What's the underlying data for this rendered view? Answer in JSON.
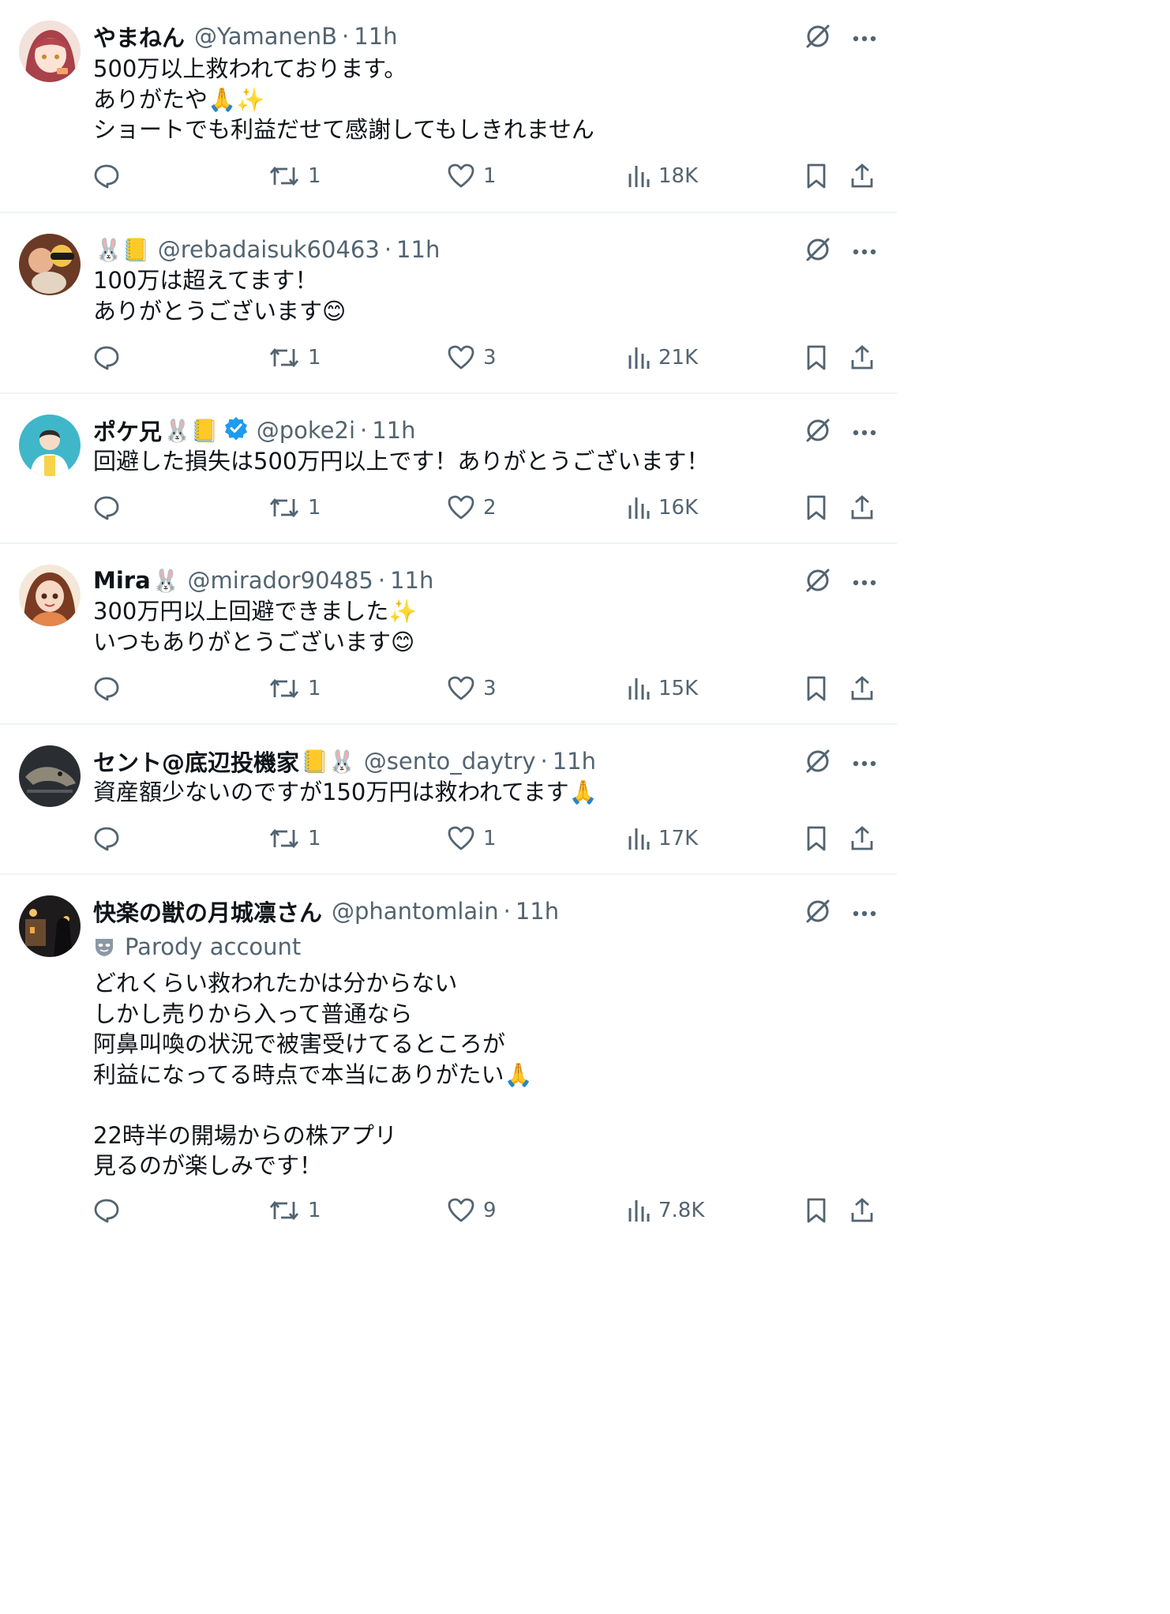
{
  "posts": [
    {
      "name": "やまねん",
      "name_emojis": "",
      "verified": false,
      "handle": "@YamanenB",
      "time": "11h",
      "parody_label": "",
      "text": "500万以上救われております。\nありがたや🙏✨\nショートでも利益だせて感謝してもしきれません",
      "stats": {
        "replies": "",
        "reposts": "1",
        "likes": "1",
        "views": "18K"
      }
    },
    {
      "name": "",
      "name_emojis": "🐰📒",
      "verified": false,
      "handle": "@rebadaisuk60463",
      "time": "11h",
      "parody_label": "",
      "text": "100万は超えてます！\nありがとうございます😊",
      "stats": {
        "replies": "",
        "reposts": "1",
        "likes": "3",
        "views": "21K"
      }
    },
    {
      "name": "ポケ兄",
      "name_emojis": "🐰📒",
      "verified": true,
      "handle": "@poke2i",
      "time": "11h",
      "parody_label": "",
      "text": "回避した損失は500万円以上です！ありがとうございます！",
      "stats": {
        "replies": "",
        "reposts": "1",
        "likes": "2",
        "views": "16K"
      }
    },
    {
      "name": "Mira",
      "name_emojis": "🐰",
      "verified": false,
      "handle": "@mirador90485",
      "time": "11h",
      "parody_label": "",
      "text": "300万円以上回避できました✨\nいつもありがとうございます😊",
      "stats": {
        "replies": "",
        "reposts": "1",
        "likes": "3",
        "views": "15K"
      }
    },
    {
      "name": "セント@底辺投機家",
      "name_emojis": "📒🐰",
      "verified": false,
      "handle": "@sento_daytry",
      "time": "11h",
      "parody_label": "",
      "text": "資産額少ないのですが150万円は救われてます🙏",
      "stats": {
        "replies": "",
        "reposts": "1",
        "likes": "1",
        "views": "17K"
      }
    },
    {
      "name": "快楽の獣の月城凛さん",
      "name_emojis": "",
      "verified": false,
      "handle": "@phantomlain",
      "time": "11h",
      "parody_label": "Parody account",
      "text": "どれくらい救われたかは分からない\nしかし売りから入って普通なら\n阿鼻叫喚の状況で被害受けてるところが\n利益になってる時点で本当にありがたい🙏\n\n22時半の開場からの株アプリ\n見るのが楽しみです！",
      "stats": {
        "replies": "",
        "reposts": "1",
        "likes": "9",
        "views": "7.8K"
      }
    }
  ],
  "icons": {
    "reply": "reply-icon",
    "repost": "repost-icon",
    "like": "heart-icon",
    "views": "views-icon",
    "bookmark": "bookmark-icon",
    "share": "share-icon",
    "grok": "grok-icon",
    "more": "more-icon",
    "parody": "parody-mask-icon",
    "verified": "verified-badge-icon"
  },
  "colors": {
    "text": "#0f1419",
    "secondary": "#536471",
    "divider": "#eff3f4",
    "verified": "#1d9bf0"
  }
}
